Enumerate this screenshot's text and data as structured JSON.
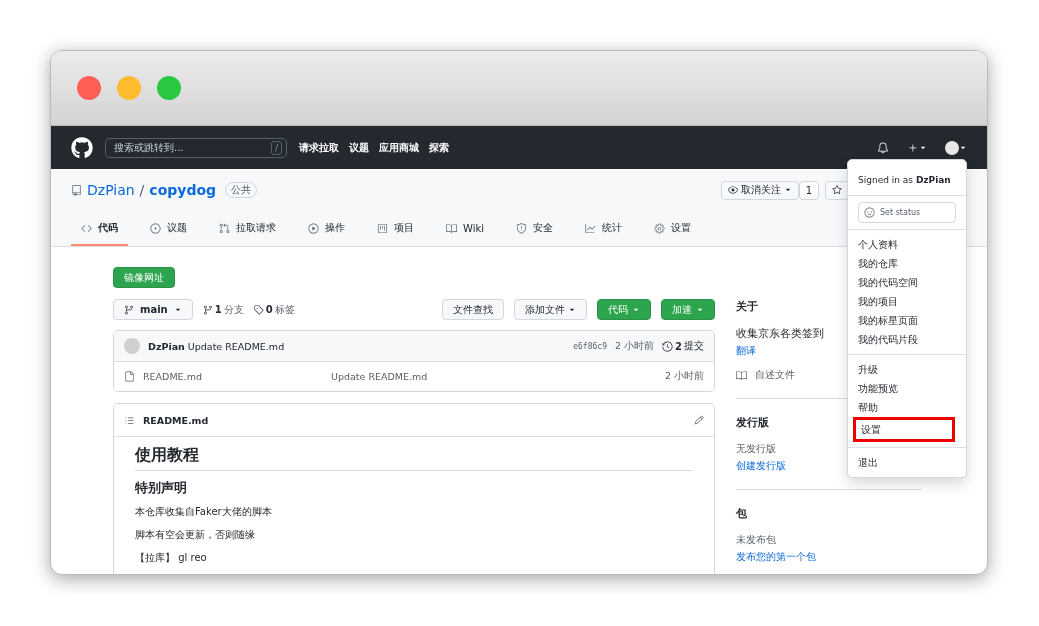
{
  "header": {
    "search_placeholder": "搜索或跳转到...",
    "search_key": "/",
    "nav": [
      "请求拉取",
      "议题",
      "应用商城",
      "探索"
    ]
  },
  "repo": {
    "owner": "DzPian",
    "separator": "/",
    "name": "copydog",
    "visibility": "公共",
    "watch_label": "取消关注",
    "watch_count": "1"
  },
  "tabs": [
    {
      "label": "代码",
      "selected": true
    },
    {
      "label": "议题",
      "selected": false
    },
    {
      "label": "拉取请求",
      "selected": false
    },
    {
      "label": "操作",
      "selected": false
    },
    {
      "label": "项目",
      "selected": false
    },
    {
      "label": "Wiki",
      "selected": false
    },
    {
      "label": "安全",
      "selected": false
    },
    {
      "label": "统计",
      "selected": false
    },
    {
      "label": "设置",
      "selected": false
    }
  ],
  "mirror_button": "镜像网址",
  "branch": {
    "name": "main",
    "branches_count": "1",
    "branches_label": "分支",
    "tags_count": "0",
    "tags_label": "标签"
  },
  "actions": [
    {
      "label": "文件查找",
      "kind": "plain",
      "caret": false
    },
    {
      "label": "添加文件",
      "kind": "plain",
      "caret": true
    },
    {
      "label": "代码",
      "kind": "primary",
      "caret": true
    },
    {
      "label": "加速",
      "kind": "primary",
      "caret": true
    }
  ],
  "commit": {
    "author": "DzPian",
    "message": "Update README.md",
    "sha": "e6f86c9",
    "time": "2 小时前",
    "count": "2",
    "count_label": "提交"
  },
  "files": [
    {
      "name": "README.md",
      "message": "Update README.md",
      "time": "2 小时前"
    }
  ],
  "readme": {
    "title": "README.md",
    "h1": "使用教程",
    "h2": "特别声明",
    "paragraphs": [
      "本仓库收集自Faker大佬的脚本",
      "脚本有空会更新，否则随缘",
      "【拉库】 gl reo"
    ]
  },
  "about": {
    "title": "关于",
    "description": "收集京东各类签到",
    "translate": "翻译",
    "readme_link": "自述文件"
  },
  "releases": {
    "title": "发行版",
    "empty": "无发行版",
    "link": "创建发行版"
  },
  "packages": {
    "title": "包",
    "empty": "未发布包",
    "link": "发布您的第一个包"
  },
  "menu": {
    "signed_in_prefix": "Signed in as",
    "user": "DzPian",
    "status_placeholder": "Set status",
    "groups": [
      [
        {
          "label": "个人资料",
          "highlighted": false
        },
        {
          "label": "我的仓库",
          "highlighted": false
        },
        {
          "label": "我的代码空间",
          "highlighted": false
        },
        {
          "label": "我的项目",
          "highlighted": false
        },
        {
          "label": "我的标星页面",
          "highlighted": false
        },
        {
          "label": "我的代码片段",
          "highlighted": false
        }
      ],
      [
        {
          "label": "升级",
          "highlighted": false
        },
        {
          "label": "功能预览",
          "highlighted": false
        },
        {
          "label": "帮助",
          "highlighted": false
        },
        {
          "label": "设置",
          "highlighted": true
        }
      ],
      [
        {
          "label": "退出",
          "highlighted": false
        }
      ]
    ]
  }
}
